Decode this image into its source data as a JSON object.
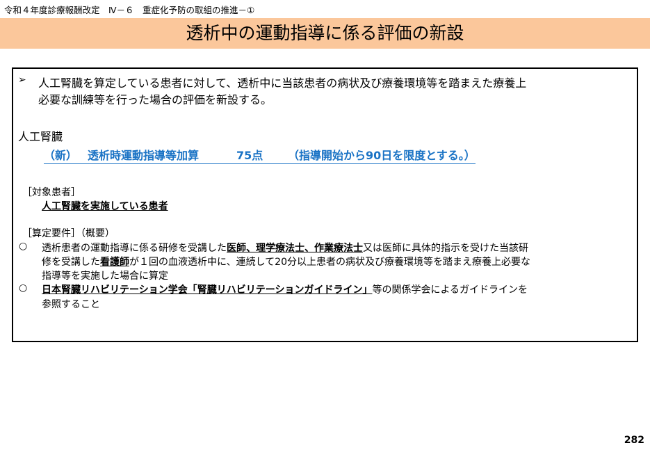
{
  "header": {
    "revision_label": "令和４年度診療報酬改定　Ⅳ－６　重症化予防の取組の推進－①"
  },
  "title": "透析中の運動指導に係る評価の新設",
  "intro": {
    "line1": "人工腎臓を算定している患者に対して、透析中に当該患者の病状及び療養環境等を踏まえた療養上",
    "line2": "必要な訓練等を行った場合の評価を新設する。"
  },
  "section_label": "人工腎臓",
  "fee": {
    "new_tag": "（新）",
    "name": "透析時運動指導等加算",
    "points": "75点",
    "limit": "（指導開始から90日を限度とする。）"
  },
  "target": {
    "heading": "［対象患者］",
    "body": "人工腎臓を実施している患者"
  },
  "requirements": {
    "heading": "［算定要件］（概要）",
    "item1": {
      "p1": "透析患者の運動指導に係る研修を受講した",
      "b1": "医師、理学療法士、作業療法士",
      "p2": "又は医師に具体的指示を受けた当該研",
      "p3": "修を受講した",
      "b2": "看護師",
      "p4": "が１回の血液透析中に、連続して20分以上患者の病状及び療養環境等を踏まえ療養上必要な",
      "p5": "指導等を実施した場合に算定"
    },
    "item2": {
      "b1": "日本腎臓リハビリテーション学会「腎臓リハビリテーションガイドライン」",
      "p1": "等の関係学会によるガイドラインを",
      "p2": "参照すること"
    }
  },
  "page_number": "282"
}
